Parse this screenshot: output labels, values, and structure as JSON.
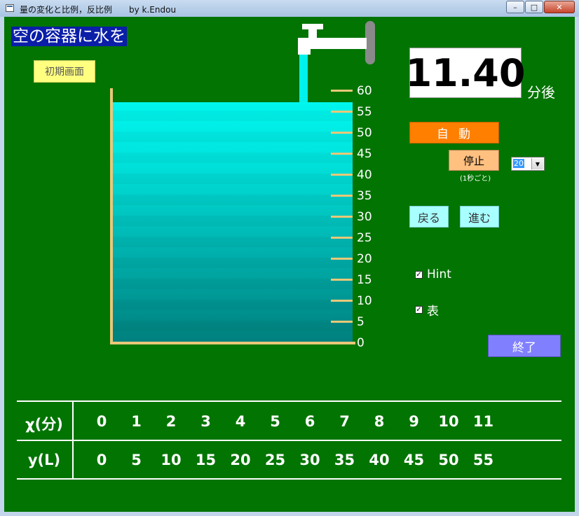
{
  "window": {
    "title": "量の変化と比例，反比例　　by k.Endou",
    "buttons": {
      "minimize": "–",
      "maximize": "□",
      "close": "✕"
    }
  },
  "heading": "空の容器に水を",
  "initial_button": "初期画面",
  "tank": {
    "scale_labels": [
      "60",
      "55",
      "50",
      "45",
      "40",
      "35",
      "30",
      "25",
      "20",
      "15",
      "10",
      "5",
      "0"
    ],
    "water_level": 57,
    "scale_max": 60
  },
  "timer": {
    "value": "11.40",
    "unit": "分後"
  },
  "controls": {
    "auto": "自動",
    "stop": "停止",
    "stop_note": "(1秒ごと)",
    "speed_value": "20",
    "back": "戻る",
    "next": "進む",
    "hint": "Hint",
    "table_toggle": "表",
    "end": "終了"
  },
  "table": {
    "x_header": "χ(分)",
    "y_header": "y(L)",
    "x_values": [
      "0",
      "1",
      "2",
      "3",
      "4",
      "5",
      "6",
      "7",
      "8",
      "9",
      "10",
      "11"
    ],
    "y_values": [
      "0",
      "5",
      "10",
      "15",
      "20",
      "25",
      "30",
      "35",
      "40",
      "45",
      "50",
      "55"
    ]
  },
  "colors": {
    "background": "#027402",
    "water": "#00e2dc",
    "tank": "#e9c878",
    "auto_button": "#ff7f00",
    "stop_button": "#ffc080",
    "nav_buttons": "#a8ffff",
    "end_button": "#8080ff",
    "initial_button": "#ffff80",
    "heading_bg": "#0a1ea8"
  }
}
